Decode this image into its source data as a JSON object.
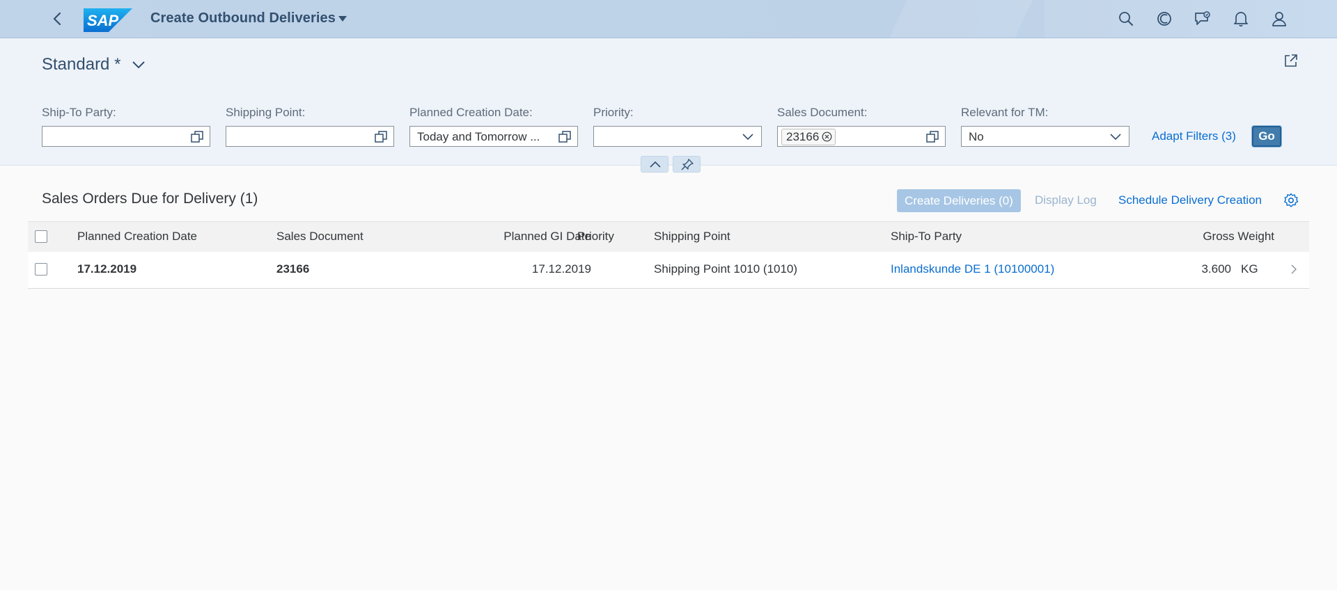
{
  "shell": {
    "app_title": "Create Outbound Deliveries",
    "logo_text": "SAP",
    "icons": [
      "back-icon",
      "search-icon",
      "copilot-icon",
      "feedback-icon",
      "notifications-icon",
      "user-icon"
    ]
  },
  "header": {
    "variant_name": "Standard *",
    "filters": {
      "ship_to_party": {
        "label": "Ship-To Party:",
        "value": ""
      },
      "shipping_point": {
        "label": "Shipping Point:",
        "value": ""
      },
      "planned_creation_date": {
        "label": "Planned Creation Date:",
        "value": "Today and Tomorrow ..."
      },
      "priority": {
        "label": "Priority:",
        "value": ""
      },
      "sales_document": {
        "label": "Sales Document:",
        "token": "23166"
      },
      "relevant_for_tm": {
        "label": "Relevant for TM:",
        "value": "No"
      }
    },
    "adapt_filters": "Adapt Filters (3)",
    "go": "Go"
  },
  "table": {
    "title": "Sales Orders Due for Delivery (1)",
    "actions": {
      "create_deliveries": "Create Deliveries (0)",
      "display_log": "Display Log",
      "schedule": "Schedule Delivery Creation"
    },
    "columns": {
      "planned_creation_date": "Planned Creation Date",
      "sales_document": "Sales Document",
      "planned_gi_date": "Planned GI Date",
      "priority": "Priority",
      "shipping_point": "Shipping Point",
      "ship_to_party": "Ship-To Party",
      "gross_weight": "Gross Weight"
    },
    "rows": [
      {
        "planned_creation_date": "17.12.2019",
        "sales_document": "23166",
        "planned_gi_date": "17.12.2019",
        "priority": "",
        "shipping_point": "Shipping Point 1010 (1010)",
        "ship_to_party": "Inlandskunde DE 1 (10100001)",
        "gross_weight": "3.600",
        "weight_unit": "KG"
      }
    ]
  },
  "colors": {
    "shell_bg": "#bfd3e9",
    "header_bg": "#eef3f9",
    "link": "#0a6ed1",
    "emphasized_button": "#427cac",
    "disabled_button": "#a7c6e5"
  }
}
